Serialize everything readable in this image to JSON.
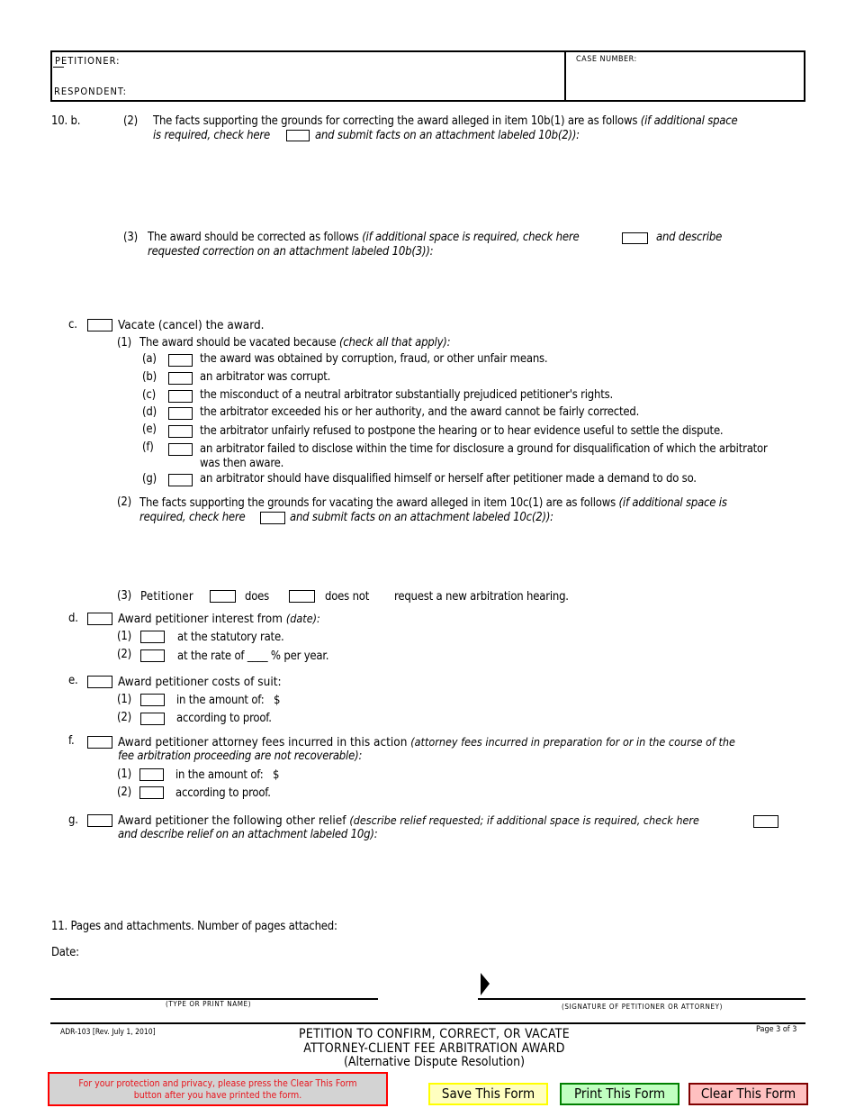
{
  "header": {
    "petitioner_label": "PETITIONER:",
    "respondent_label": "RESPONDENT:",
    "case_number_label": "CASE NUMBER:"
  },
  "item10b": {
    "num": "10. b.",
    "p2": {
      "num": "(2)",
      "text": "The facts supporting the grounds for correcting the award alleged in item 10b(1) are as follows ",
      "italic1": "(if additional space",
      "italic2a": "is required, check here",
      "italic2b": "and submit facts on an attachment labeled 10b(2)):"
    },
    "p3": {
      "num": "(3)",
      "text": "The award should be corrected as follows ",
      "italic1": "(if additional space is required, check here",
      "italic1b": "and describe",
      "italic2": "requested correction on an attachment labeled 10b(3)):"
    }
  },
  "item10c": {
    "letter": "c.",
    "label": "Vacate (cancel) the award.",
    "p1": {
      "num": "(1)",
      "text": "The award should be vacated because ",
      "italic": "(check all that apply):",
      "options": [
        {
          "letter": "(a)",
          "text": "the award was obtained by corruption, fraud, or other unfair means."
        },
        {
          "letter": "(b)",
          "text": "an arbitrator was corrupt."
        },
        {
          "letter": "(c)",
          "text": "the misconduct of a neutral arbitrator substantially prejudiced petitioner's rights."
        },
        {
          "letter": "(d)",
          "text": "the arbitrator exceeded his or her authority, and the award cannot be fairly corrected."
        },
        {
          "letter": "(e)",
          "text": "the arbitrator unfairly refused to postpone the hearing or to hear evidence useful to settle the dispute."
        },
        {
          "letter": "(f)",
          "text": "an arbitrator failed to disclose within the time for disclosure a ground for disqualification of which the arbitrator",
          "text2": "was then aware."
        },
        {
          "letter": "(g)",
          "text": "an arbitrator should have disqualified himself or herself after petitioner made a demand to do so."
        }
      ]
    },
    "p2": {
      "num": "(2)",
      "text": "The facts supporting the grounds for vacating the award alleged in item 10c(1) are as follows ",
      "italic1": "(if additional space is",
      "italic2a": "required, check here",
      "italic2b": "and submit facts on an attachment labeled 10c(2)):"
    },
    "p3": {
      "num": "(3)",
      "petitioner": "Petitioner",
      "does": "does",
      "does_not": "does not",
      "rest": "request a new arbitration hearing."
    }
  },
  "item10d": {
    "letter": "d.",
    "label": "Award petitioner interest from ",
    "italic": "(date):",
    "opt1_num": "(1)",
    "opt1": "at the statutory rate.",
    "opt2_num": "(2)",
    "opt2": "at the rate of ____ % per year."
  },
  "item10e": {
    "letter": "e.",
    "label": "Award petitioner costs of suit:",
    "opt1_num": "(1)",
    "opt1": "in the amount of:   $",
    "opt2_num": "(2)",
    "opt2": "according to proof."
  },
  "item10f": {
    "letter": "f.",
    "label": "Award petitioner attorney fees incurred in this action ",
    "italic1": "(attorney fees incurred in preparation for or in the course of the",
    "italic2": "fee arbitration proceeding are not recoverable):",
    "opt1_num": "(1)",
    "opt1": "in the amount of:   $",
    "opt2_num": "(2)",
    "opt2": "according to proof."
  },
  "item10g": {
    "letter": "g.",
    "label": "Award petitioner the following other relief ",
    "italic1": "(describe relief requested; if additional space is required, check here",
    "italic2": "and describe relief on an attachment labeled 10g):"
  },
  "item11": {
    "text": "11. Pages and attachments. Number of pages attached:"
  },
  "date_label": "Date:",
  "name_caption": "(TYPE OR PRINT NAME)",
  "signature_caption": "(SIGNATURE OF PETITIONER OR ATTORNEY)",
  "footer": {
    "form_id": "ADR-103 [Rev. July 1, 2010]",
    "title1": "PETITION TO CONFIRM, CORRECT, OR VACATE",
    "title2": "ATTORNEY-CLIENT FEE ARBITRATION AWARD",
    "title3": "(Alternative Dispute Resolution)",
    "page": "Page 3 of 3"
  },
  "notice": {
    "line1": "For your protection and privacy, please press the Clear This Form",
    "line2": "button after you have printed the form."
  },
  "buttons": {
    "save": "Save This Form",
    "print": "Print This Form",
    "clear": "Clear This Form"
  },
  "colors": {
    "notice_text": "#e8141c",
    "notice_border": "#ff0000",
    "notice_bg": "#d3d3d3",
    "save_bg": "#ffffc0",
    "save_border": "#ffff00",
    "print_bg": "#c0ffc0",
    "print_border": "#008000",
    "clear_bg": "#ffc0c0",
    "clear_border": "#800000"
  }
}
